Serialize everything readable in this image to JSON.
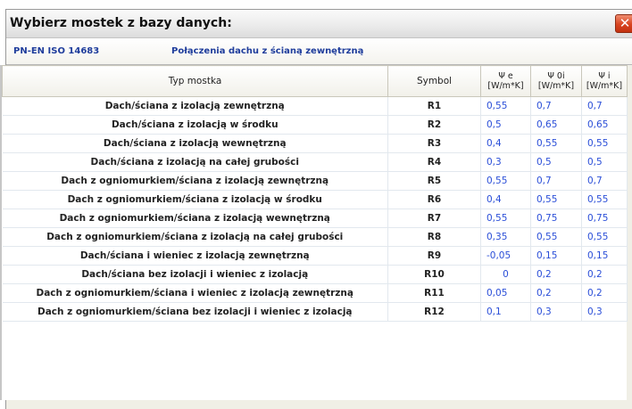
{
  "window": {
    "title": "Wybierz mostek z bazy danych:",
    "close_glyph": "✕"
  },
  "crumbs": {
    "norm": "PN-EN ISO 14683",
    "category": "Połączenia dachu z ścianą zewnętrzną"
  },
  "table": {
    "headers": {
      "name": "Typ mostka",
      "symbol": "Symbol",
      "psi_e": "Ψ e",
      "psi_oi": "Ψ 0i",
      "psi_i": "Ψ i",
      "unit": "[W/m*K]"
    },
    "rows": [
      {
        "name": "Dach/ściana z izolacją zewnętrzną",
        "symbol": "R1",
        "psi_e": "0,55",
        "psi_oi": "0,7",
        "psi_i": "0,7"
      },
      {
        "name": "Dach/ściana z izolacją w środku",
        "symbol": "R2",
        "psi_e": "0,5",
        "psi_oi": "0,65",
        "psi_i": "0,65"
      },
      {
        "name": "Dach/ściana z izolacją wewnętrzną",
        "symbol": "R3",
        "psi_e": "0,4",
        "psi_oi": "0,55",
        "psi_i": "0,55"
      },
      {
        "name": "Dach/ściana z izolacją na całej grubości",
        "symbol": "R4",
        "psi_e": "0,3",
        "psi_oi": "0,5",
        "psi_i": "0,5"
      },
      {
        "name": "Dach z ogniomurkiem/ściana z izolacją zewnętrzną",
        "symbol": "R5",
        "psi_e": "0,55",
        "psi_oi": "0,7",
        "psi_i": "0,7"
      },
      {
        "name": "Dach z ogniomurkiem/ściana z izolacją w środku",
        "symbol": "R6",
        "psi_e": "0,4",
        "psi_oi": "0,55",
        "psi_i": "0,55"
      },
      {
        "name": "Dach z ogniomurkiem/ściana z izolacją wewnętrzną",
        "symbol": "R7",
        "psi_e": "0,55",
        "psi_oi": "0,75",
        "psi_i": "0,75"
      },
      {
        "name": "Dach z ogniomurkiem/ściana z izolacją na całej grubości",
        "symbol": "R8",
        "psi_e": "0,35",
        "psi_oi": "0,55",
        "psi_i": "0,55"
      },
      {
        "name": "Dach/ściana i wieniec z izolacją zewnętrzną",
        "symbol": "R9",
        "psi_e": "-0,05",
        "psi_oi": "0,15",
        "psi_i": "0,15"
      },
      {
        "name": "Dach/ściana bez izolacji i wieniec z izolacją",
        "symbol": "R10",
        "psi_e": "0",
        "psi_oi": "0,2",
        "psi_i": "0,2"
      },
      {
        "name": "Dach z ogniomurkiem/ściana i wieniec z izolacją zewnętrzną",
        "symbol": "R11",
        "psi_e": "0,05",
        "psi_oi": "0,2",
        "psi_i": "0,2"
      },
      {
        "name": "Dach z ogniomurkiem/ściana bez izolacji i wieniec z izolacją",
        "symbol": "R12",
        "psi_e": "0,1",
        "psi_oi": "0,3",
        "psi_i": "0,3"
      }
    ]
  },
  "colors": {
    "value_text": "#2a4ed8",
    "crumb_text": "#1f3d9c",
    "close_button": "#d8431f"
  }
}
